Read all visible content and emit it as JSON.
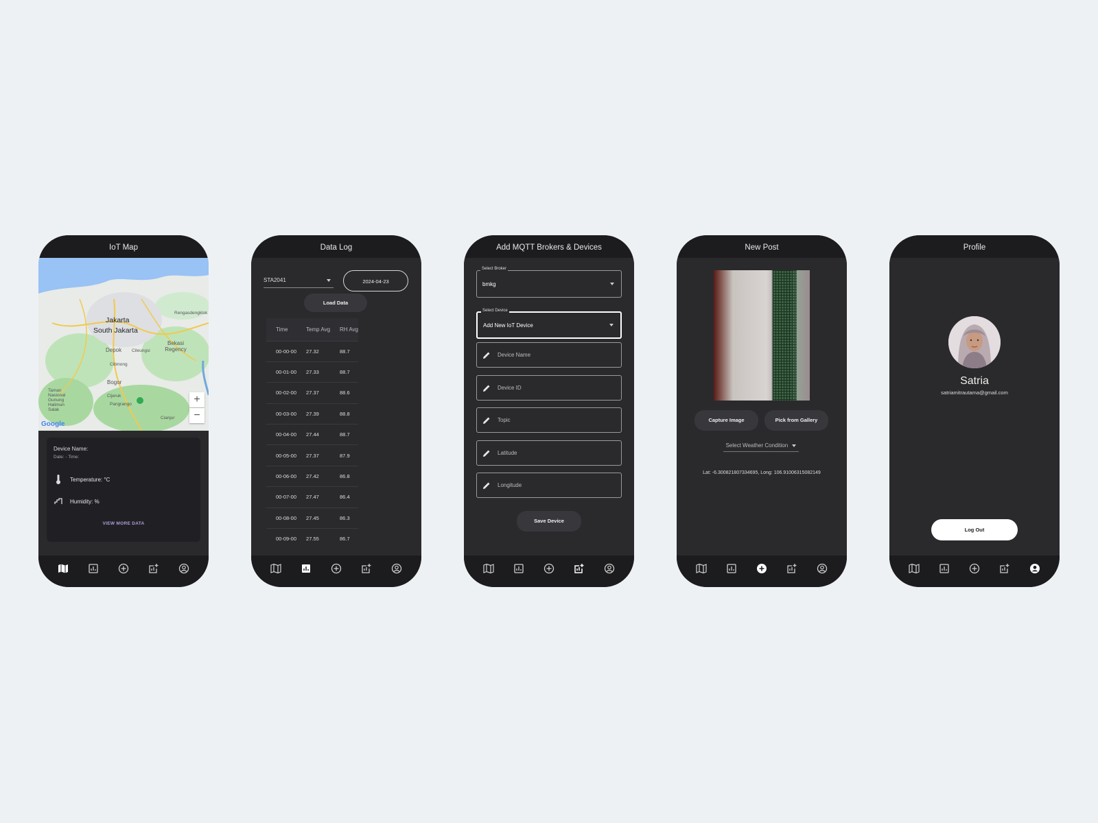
{
  "nav_icons": [
    "map-icon",
    "data-log-icon",
    "add-circle-icon",
    "add-chart-icon",
    "account-circle-icon"
  ],
  "iot_map": {
    "title": "IoT Map",
    "map_labels": [
      "Jakarta",
      "South Jakarta",
      "Depok",
      "Bekasi Regency",
      "Bogor",
      "Cibinong",
      "Cileungsi",
      "Rengasdengklok",
      "Taman Nasional Gunung Halimun Salak",
      "Pangrango",
      "Cianjur",
      "Cijeruk"
    ],
    "map_brand": "Google",
    "device_name_label": "Device Name:",
    "date_time_label": "Date:  - Time:",
    "temperature_label": "Temperature:  °C",
    "humidity_label": "Humidity:  %",
    "view_more": "VIEW MORE DATA",
    "zoom_in": "+",
    "zoom_out": "−"
  },
  "data_log": {
    "title": "Data Log",
    "station": "STA2041",
    "date": "2024-04-23",
    "load_button": "Load Data",
    "columns": [
      "Time",
      "Temp Avg",
      "RH Avg"
    ],
    "rows": [
      [
        "00-00-00",
        "27.32",
        "88.7"
      ],
      [
        "00-01-00",
        "27.33",
        "88.7"
      ],
      [
        "00-02-00",
        "27.37",
        "88.6"
      ],
      [
        "00-03-00",
        "27.39",
        "88.8"
      ],
      [
        "00-04-00",
        "27.44",
        "88.7"
      ],
      [
        "00-05-00",
        "27.37",
        "87.9"
      ],
      [
        "00-06-00",
        "27.42",
        "86.8"
      ],
      [
        "00-07-00",
        "27.47",
        "86.4"
      ],
      [
        "00-08-00",
        "27.45",
        "86.3"
      ],
      [
        "00-09-00",
        "27.55",
        "86.7"
      ]
    ]
  },
  "add_device": {
    "title": "Add MQTT Brokers & Devices",
    "broker_label": "Select Broker",
    "broker_value": "bmkg",
    "device_label": "Select Device",
    "device_value": "Add New IoT Device",
    "fields": [
      "Device Name",
      "Device ID",
      "Topic",
      "Latitude",
      "Longitude"
    ],
    "save_button": "Save Device"
  },
  "new_post": {
    "title": "New Post",
    "capture_button": "Capture Image",
    "gallery_button": "Pick from Gallery",
    "weather_placeholder": "Select Weather Condition",
    "coordinates": "Lat: -6.300821807334695, Long: 106.91006315082149"
  },
  "profile": {
    "title": "Profile",
    "name": "Satria",
    "email": "satriamitrautama@gmail.com",
    "logout_button": "Log Out"
  },
  "colors": {
    "background": "#eef1f4",
    "phone_frame": "#1c1c1e",
    "screen": "#2a2a2c",
    "accent_purple": "#b39ddb"
  }
}
